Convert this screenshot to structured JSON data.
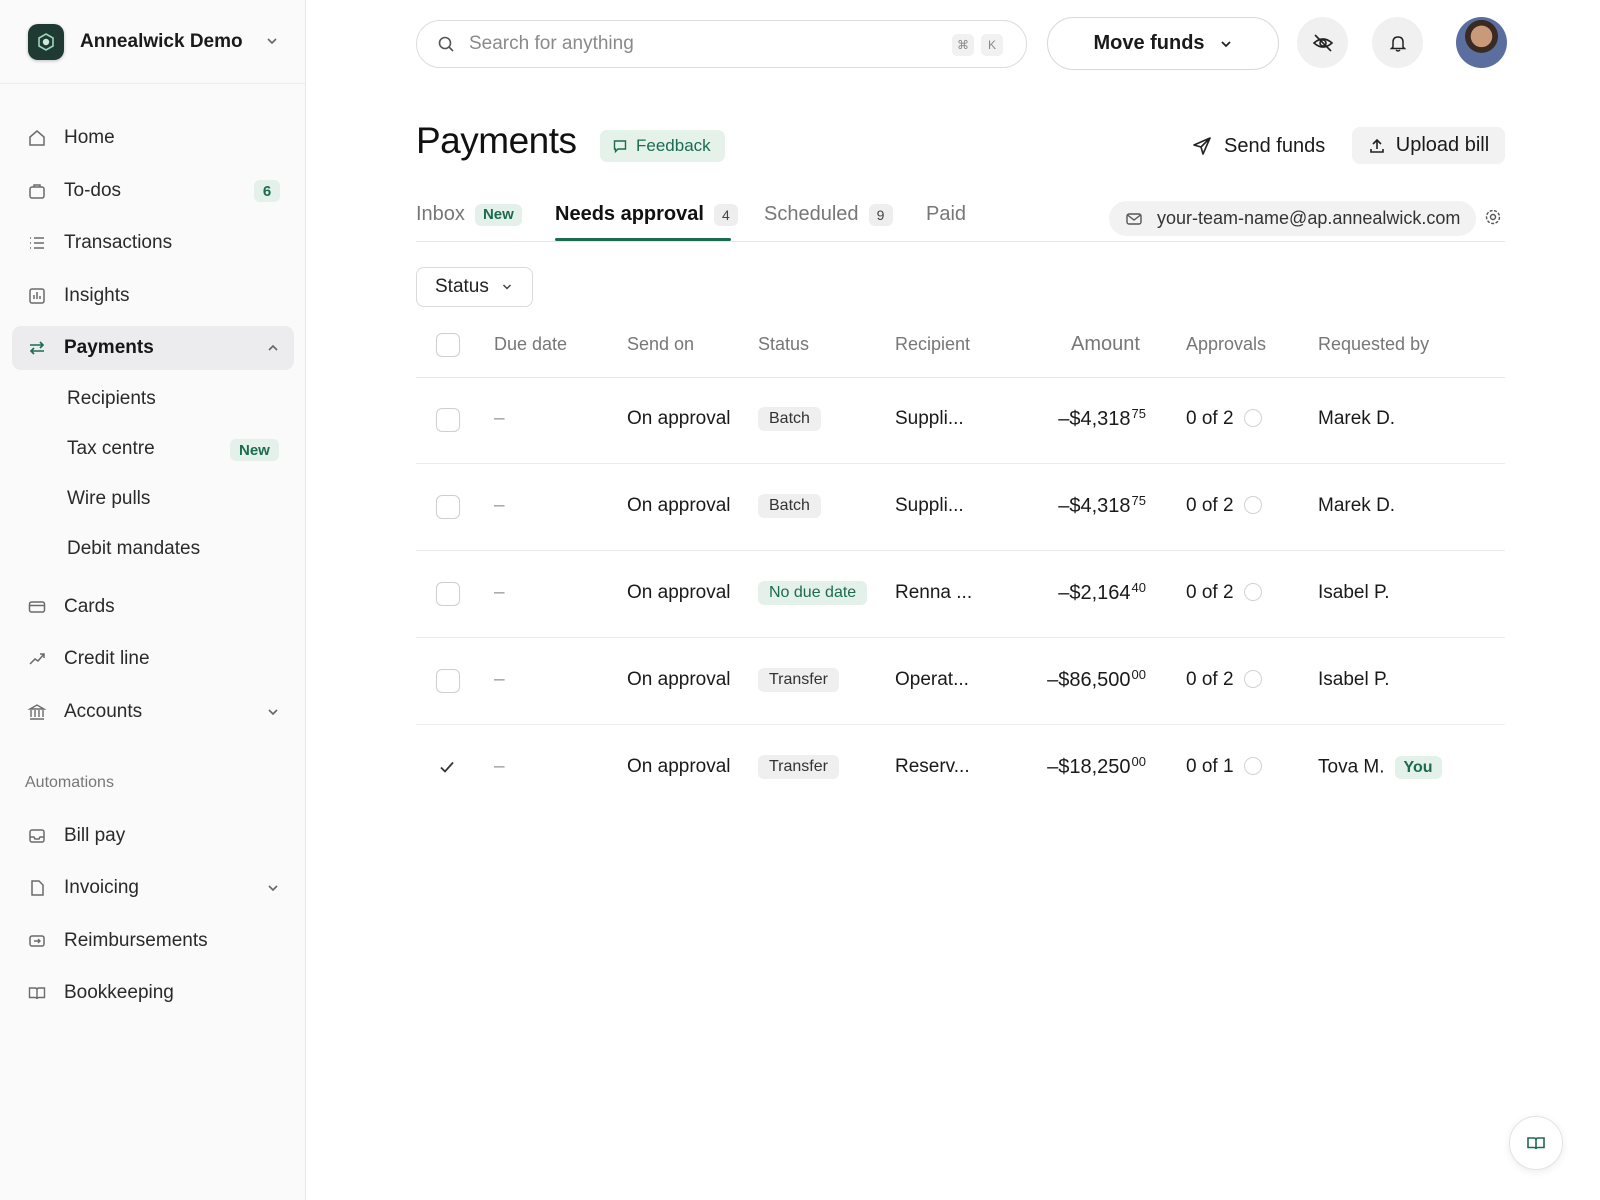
{
  "org": {
    "name": "Annealwick Demo"
  },
  "sidebar": {
    "items": [
      {
        "label": "Home"
      },
      {
        "label": "To-dos",
        "count": "6"
      },
      {
        "label": "Transactions"
      },
      {
        "label": "Insights"
      },
      {
        "label": "Payments"
      },
      {
        "label": "Cards"
      },
      {
        "label": "Credit line"
      },
      {
        "label": "Accounts"
      }
    ],
    "payments_sub": [
      {
        "label": "Recipients"
      },
      {
        "label": "Tax centre",
        "badge": "New"
      },
      {
        "label": "Wire pulls"
      },
      {
        "label": "Debit mandates"
      }
    ],
    "automations_label": "Automations",
    "automations": [
      {
        "label": "Bill pay"
      },
      {
        "label": "Invoicing"
      },
      {
        "label": "Reimbursements"
      },
      {
        "label": "Bookkeeping"
      }
    ]
  },
  "topbar": {
    "search_placeholder": "Search for anything",
    "shortcut_cmd": "⌘",
    "shortcut_key": "K",
    "move_funds": "Move funds"
  },
  "page": {
    "title": "Payments",
    "feedback": "Feedback",
    "send_funds": "Send funds",
    "upload_bill": "Upload bill"
  },
  "tabs": [
    {
      "label": "Inbox",
      "badge": "New"
    },
    {
      "label": "Needs approval",
      "count": "4"
    },
    {
      "label": "Scheduled",
      "count": "9"
    },
    {
      "label": "Paid"
    }
  ],
  "email": "your-team-name@ap.annealwick.com",
  "filter": {
    "status": "Status"
  },
  "table": {
    "columns": [
      "Due date",
      "Send on",
      "Status",
      "Recipient",
      "Amount",
      "Approvals",
      "Requested by"
    ],
    "rows": [
      {
        "due": "–",
        "send_on": "On approval",
        "status": "Batch",
        "recipient": "Suppli...",
        "amount_main": "–$4,318",
        "amount_cents": "75",
        "approvals": "0 of 2",
        "requested_by": "Marek D."
      },
      {
        "due": "–",
        "send_on": "On approval",
        "status": "Batch",
        "recipient": "Suppli...",
        "amount_main": "–$4,318",
        "amount_cents": "75",
        "approvals": "0 of 2",
        "requested_by": "Marek D."
      },
      {
        "due": "–",
        "send_on": "On approval",
        "status": "No due date",
        "recipient": "Renna ...",
        "amount_main": "–$2,164",
        "amount_cents": "40",
        "approvals": "0 of 2",
        "requested_by": "Isabel P."
      },
      {
        "due": "–",
        "send_on": "On approval",
        "status": "Transfer",
        "recipient": "Operat...",
        "amount_main": "–$86,500",
        "amount_cents": "00",
        "approvals": "0 of 2",
        "requested_by": "Isabel P."
      },
      {
        "due": "–",
        "send_on": "On approval",
        "status": "Transfer",
        "recipient": "Reserv...",
        "amount_main": "–$18,250",
        "amount_cents": "00",
        "approvals": "0 of 1",
        "requested_by": "Tova M.",
        "badge": "You",
        "checked": true
      }
    ]
  },
  "colors": {
    "accent": "#1b6b52",
    "accent_bg": "#e3f1ea"
  }
}
